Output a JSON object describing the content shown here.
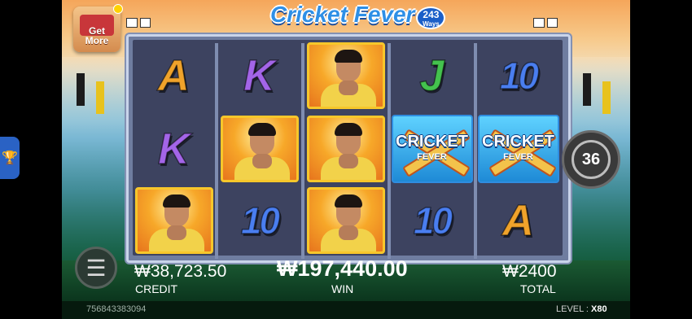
{
  "game": {
    "logo_title": "Cricket Fever",
    "logo_ways_number": "243",
    "logo_ways_word": "Ways"
  },
  "buttons": {
    "get_more_label": "Get\nMore",
    "trophy_icon": "trophy-icon",
    "menu_icon": "hamburger-icon"
  },
  "spin": {
    "remaining_label": "36"
  },
  "reels": {
    "wild_title": "CRICKET",
    "wild_subtitle": "FEVER",
    "grid": [
      [
        "A",
        "K",
        "player",
        "J",
        "10"
      ],
      [
        "K",
        "player",
        "player",
        "wild",
        "wild"
      ],
      [
        "player",
        "10",
        "player",
        "10",
        "A"
      ]
    ]
  },
  "status": {
    "credit_value": "₩38,723.50",
    "credit_label": "CREDIT",
    "win_value": "₩197,440.00",
    "win_label": "WIN",
    "total_value": "₩2400",
    "total_label": "TOTAL",
    "transaction_id": "756843383094",
    "level_label": "LEVEL :",
    "level_value": "X80"
  },
  "colors": {
    "A": "#f0a32b",
    "K": "#a365e8",
    "J": "#44c24e",
    "10": "#4a7ef0",
    "player_frame": "#f7c72b",
    "wild_bg": "#1e8ad6"
  }
}
